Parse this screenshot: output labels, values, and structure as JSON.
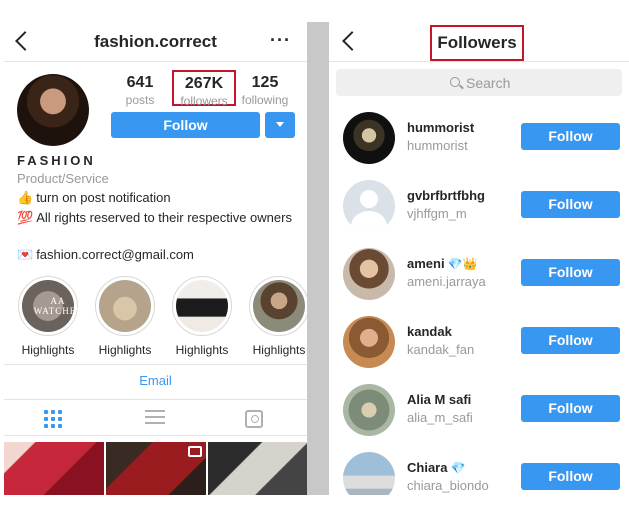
{
  "profile": {
    "username": "fashion.correct",
    "more_icon": "more-icon",
    "stats": {
      "posts_value": "641",
      "posts_label": "posts",
      "followers_value": "267K",
      "followers_label": "followers",
      "following_value": "125",
      "following_label": "following"
    },
    "follow_label": "Follow",
    "bio": {
      "name": "FASHION",
      "category": "Product/Service",
      "line1": "turn on post notification",
      "line1_emoji": "👍",
      "line2": "All rights reserved to their respective owners",
      "line2_emoji": "💯",
      "line3": "fashion.correct@gmail.com",
      "line3_emoji": "💌"
    },
    "highlights": [
      {
        "label": "Highlights",
        "overlay_text": "AA WATCHES"
      },
      {
        "label": "Highlights"
      },
      {
        "label": "Highlights"
      },
      {
        "label": "Highlights"
      }
    ],
    "email_label": "Email",
    "tabs": [
      "grid-icon",
      "list-icon",
      "tagged-icon"
    ]
  },
  "followers_screen": {
    "title": "Followers",
    "search_placeholder": "Search",
    "follow_label": "Follow",
    "items": [
      {
        "name": "hummorist",
        "username": "hummorist",
        "badges": ""
      },
      {
        "name": "gvbrfbrtfbhg",
        "username": "vjhffgm_m",
        "badges": ""
      },
      {
        "name": "ameni",
        "username": "ameni.jarraya",
        "badges": "💎👑"
      },
      {
        "name": "kandak",
        "username": "kandak_fan",
        "badges": ""
      },
      {
        "name": "Alia M safi",
        "username": "alia_m_safi",
        "badges": ""
      },
      {
        "name": "Chiara",
        "username": "chiara_biondo",
        "badges": "💎"
      }
    ]
  },
  "colors": {
    "accent": "#3897f0",
    "highlight_box": "#c4162a",
    "secondary_text": "#999999"
  }
}
